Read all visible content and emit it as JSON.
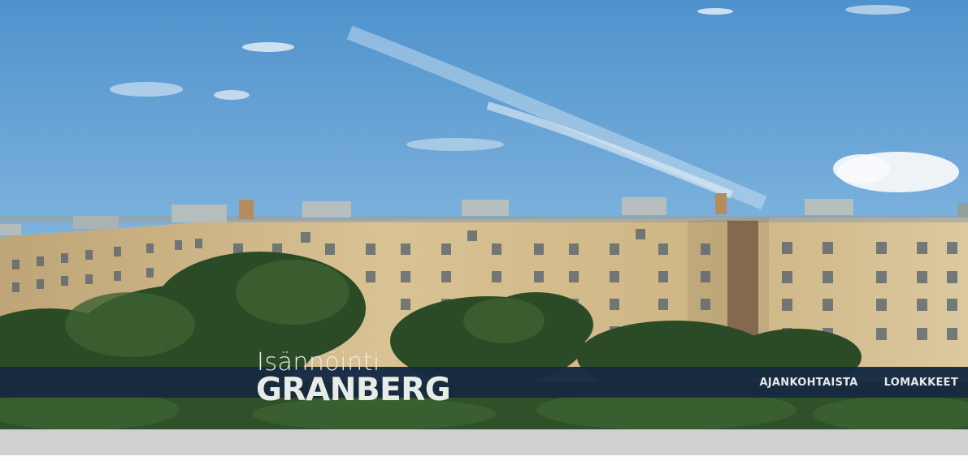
{
  "site": {
    "logo_top": "Isännöinti",
    "logo_bottom": "GRANBERG"
  },
  "nav": {
    "items": [
      {
        "label": "AJANKOHTAISTA"
      },
      {
        "label": "LOMAKKEET"
      }
    ]
  },
  "colors": {
    "navbar": "#172a40",
    "sky": "#6aa6d6",
    "building": "#cfb98a",
    "trees": "#2d4f2a",
    "footer_band": "#cfd0d1"
  }
}
